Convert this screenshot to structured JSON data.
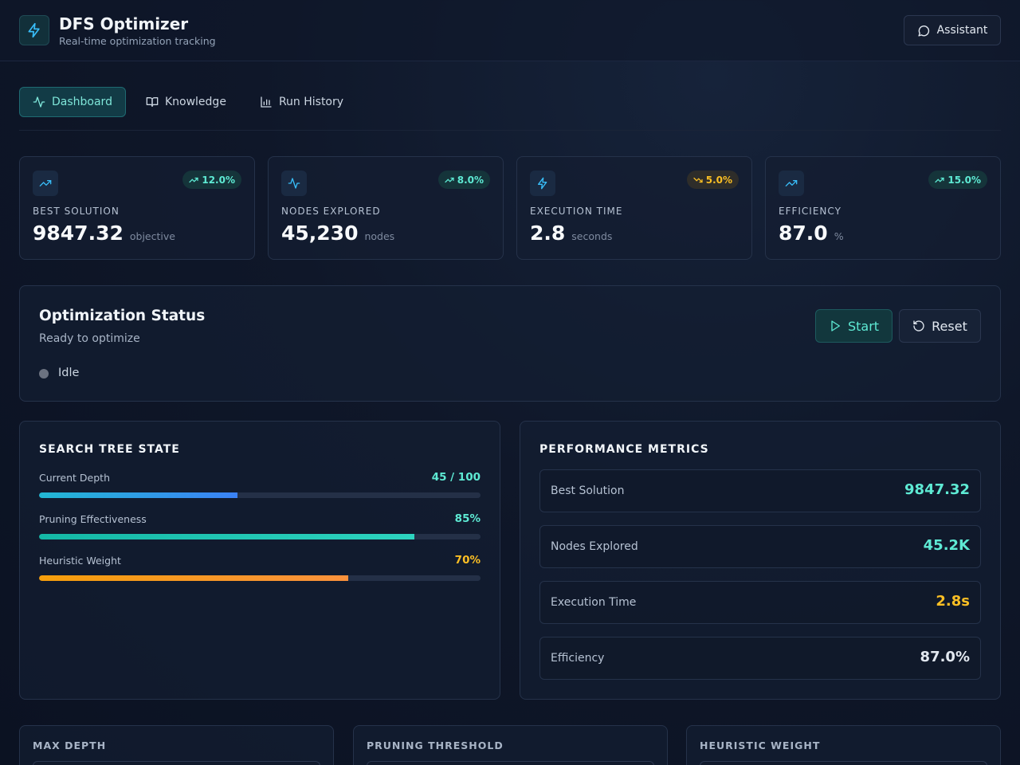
{
  "header": {
    "title": "DFS Optimizer",
    "subtitle": "Real-time optimization tracking",
    "logo_icon": "zap-icon",
    "assistant_label": "Assistant"
  },
  "tabs": [
    {
      "label": "Dashboard",
      "icon": "activity-icon",
      "active": true
    },
    {
      "label": "Knowledge",
      "icon": "book-open-icon",
      "active": false
    },
    {
      "label": "Run History",
      "icon": "bar-chart-icon",
      "active": false
    }
  ],
  "stats": [
    {
      "label": "BEST SOLUTION",
      "value": "9847.32",
      "unit": "objective",
      "badge": "12.0%",
      "trend": "up",
      "icon": "trending-up-icon"
    },
    {
      "label": "NODES EXPLORED",
      "value": "45,230",
      "unit": "nodes",
      "badge": "8.0%",
      "trend": "up",
      "icon": "activity-icon"
    },
    {
      "label": "EXECUTION TIME",
      "value": "2.8",
      "unit": "seconds",
      "badge": "5.0%",
      "trend": "down",
      "icon": "zap-icon"
    },
    {
      "label": "EFFICIENCY",
      "value": "87.0",
      "unit": "%",
      "badge": "15.0%",
      "trend": "up",
      "icon": "trending-up-icon"
    }
  ],
  "status": {
    "title": "Optimization Status",
    "subtitle": "Ready to optimize",
    "state": "Idle",
    "start_label": "Start",
    "reset_label": "Reset"
  },
  "search_tree": {
    "title": "SEARCH TREE STATE",
    "bars": [
      {
        "label": "Current Depth",
        "value": "45 / 100",
        "fraction": 0.45,
        "color": "#5eead4"
      },
      {
        "label": "Pruning Effectiveness",
        "value": "85%",
        "fraction": 0.85,
        "color": "#5eead4"
      },
      {
        "label": "Heuristic Weight",
        "value": "70%",
        "fraction": 0.7,
        "color": "#fbbf24"
      }
    ]
  },
  "performance": {
    "title": "PERFORMANCE METRICS",
    "rows": [
      {
        "label": "Best Solution",
        "value": "9847.32",
        "color": "#5eead4"
      },
      {
        "label": "Nodes Explored",
        "value": "45.2K",
        "color": "#5eead4"
      },
      {
        "label": "Execution Time",
        "value": "2.8s",
        "color": "#fbbf24"
      },
      {
        "label": "Efficiency",
        "value": "87.0%",
        "color": "#e2e8f0"
      }
    ]
  },
  "params": [
    {
      "title": "MAX DEPTH"
    },
    {
      "title": "PRUNING THRESHOLD"
    },
    {
      "title": "HEURISTIC WEIGHT"
    }
  ],
  "colors": {
    "accent": "#5eead4",
    "warning": "#fbbf24",
    "background": "#0f1729"
  }
}
